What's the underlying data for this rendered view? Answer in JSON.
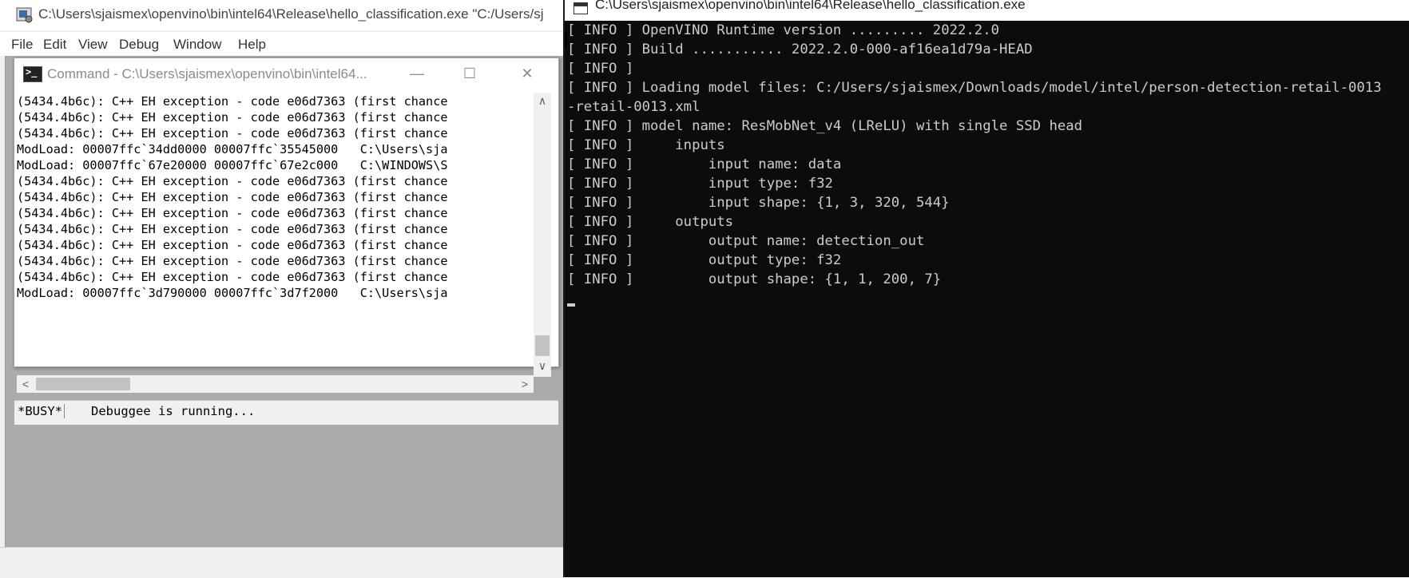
{
  "debugger": {
    "title": "C:\\Users\\sjaismex\\openvino\\bin\\intel64\\Release\\hello_classification.exe \"C:/Users/sj",
    "menu": [
      "File",
      "Edit",
      "View",
      "Debug",
      "Window",
      "Help"
    ]
  },
  "command_window": {
    "title": "Command - C:\\Users\\sjaismex\\openvino\\bin\\intel64...",
    "log": [
      "(5434.4b6c): C++ EH exception - code e06d7363 (first chance",
      "(5434.4b6c): C++ EH exception - code e06d7363 (first chance",
      "(5434.4b6c): C++ EH exception - code e06d7363 (first chance",
      "ModLoad: 00007ffc`34dd0000 00007ffc`35545000   C:\\Users\\sja",
      "ModLoad: 00007ffc`67e20000 00007ffc`67e2c000   C:\\WINDOWS\\S",
      "(5434.4b6c): C++ EH exception - code e06d7363 (first chance",
      "(5434.4b6c): C++ EH exception - code e06d7363 (first chance",
      "(5434.4b6c): C++ EH exception - code e06d7363 (first chance",
      "(5434.4b6c): C++ EH exception - code e06d7363 (first chance",
      "(5434.4b6c): C++ EH exception - code e06d7363 (first chance",
      "(5434.4b6c): C++ EH exception - code e06d7363 (first chance",
      "(5434.4b6c): C++ EH exception - code e06d7363 (first chance",
      "ModLoad: 00007ffc`3d790000 00007ffc`3d7f2000   C:\\Users\\sja"
    ],
    "status_busy": "*BUSY*",
    "status_message": "Debuggee is running..."
  },
  "console": {
    "title": "C:\\Users\\sjaismex\\openvino\\bin\\intel64\\Release\\hello_classification.exe",
    "lines": [
      "[ INFO ] OpenVINO Runtime version ......... 2022.2.0",
      "[ INFO ] Build ........... 2022.2.0-000-af16ea1d79a-HEAD",
      "[ INFO ]",
      "[ INFO ] Loading model files: C:/Users/sjaismex/Downloads/model/intel/person-detection-retail-0013",
      "-retail-0013.xml",
      "[ INFO ] model name: ResMobNet_v4 (LReLU) with single SSD head",
      "[ INFO ]     inputs",
      "[ INFO ]         input name: data",
      "[ INFO ]         input type: f32",
      "[ INFO ]         input shape: {1, 3, 320, 544}",
      "[ INFO ]     outputs",
      "[ INFO ]         output name: detection_out",
      "[ INFO ]         output type: f32",
      "[ INFO ]         output shape: {1, 1, 200, 7}"
    ]
  }
}
